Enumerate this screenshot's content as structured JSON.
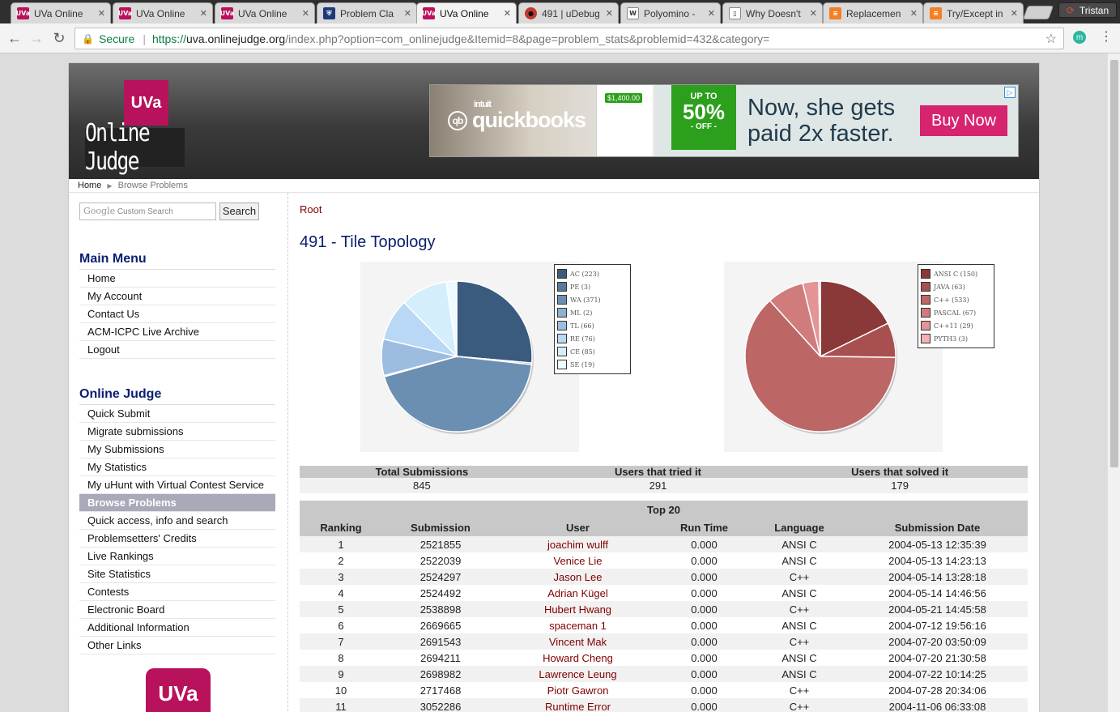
{
  "browser": {
    "tabs": [
      {
        "label": "UVa Online ",
        "favicon": "UVa",
        "color": "#b8125c"
      },
      {
        "label": "UVa Online ",
        "favicon": "UVa",
        "color": "#b8125c"
      },
      {
        "label": "UVa Online ",
        "favicon": "UVa",
        "color": "#b8125c"
      },
      {
        "label": "Problem Cla",
        "favicon": "shield",
        "color": "#1f3a7a"
      },
      {
        "label": "UVa Online ",
        "favicon": "UVa",
        "color": "#b8125c"
      },
      {
        "label": "491 | uDebug",
        "favicon": "bug",
        "color": "#c0392b"
      },
      {
        "label": "Polyomino - ",
        "favicon": "W",
        "color": "#ffffff"
      },
      {
        "label": "Why Doesn't",
        "favicon": "doc",
        "color": "#ffffff"
      },
      {
        "label": "Replacemen",
        "favicon": "stack",
        "color": "#f48024"
      },
      {
        "label": "Try/Except in",
        "favicon": "stack",
        "color": "#f48024"
      }
    ],
    "active_tab_index": 4,
    "profile_name": "Tristan",
    "secure_label": "Secure",
    "url_scheme": "https://",
    "url_host": "uva.onlinejudge.org",
    "url_path": "/index.php?option=com_onlinejudge&Itemid=8&page=problem_stats&problemid=432&category=",
    "extension_letter": "m"
  },
  "site": {
    "logo_box": "UVa",
    "logo_text": "Online Judge",
    "ad": {
      "intuit": "intuit",
      "brand": "quickbooks",
      "amount": "$1,400.00",
      "badge_top": "UP TO",
      "badge_pct": "50%",
      "badge_off": "- OFF -",
      "headline": "Now, she gets paid 2x faster.",
      "cta": "Buy Now"
    },
    "breadcrumb": {
      "home": "Home",
      "current": "Browse Problems"
    },
    "search": {
      "placeholder": "Custom Search",
      "button": "Search"
    },
    "main_menu": {
      "title": "Main Menu",
      "items": [
        "Home",
        "My Account",
        "Contact Us",
        "ACM-ICPC Live Archive",
        "Logout"
      ]
    },
    "oj_menu": {
      "title": "Online Judge",
      "items": [
        "Quick Submit",
        "Migrate submissions",
        "My Submissions",
        "My Statistics",
        "My uHunt with Virtual Contest Service",
        "Browse Problems",
        "Quick access, info and search",
        "Problemsetters' Credits",
        "Live Rankings",
        "Site Statistics",
        "Contests",
        "Electronic Board",
        "Additional Information",
        "Other Links"
      ],
      "active_index": 5
    },
    "bottom_logo": "UVa"
  },
  "problem": {
    "root_link": "Root",
    "title": "491 - Tile Topology"
  },
  "chart_data": [
    {
      "type": "pie",
      "title": "",
      "labels": [
        "AC (223)",
        "PE (3)",
        "WA (371)",
        "ML (2)",
        "TL (66)",
        "RE (76)",
        "CE (85)",
        "SE (19)"
      ],
      "values": [
        223,
        3,
        371,
        2,
        66,
        76,
        85,
        19
      ],
      "colors": [
        "#3a5a7e",
        "#5a7898",
        "#6b8fb3",
        "#8fafcd",
        "#9dbde0",
        "#b8d8f6",
        "#d4eefc",
        "#eefaff"
      ]
    },
    {
      "type": "pie",
      "title": "",
      "labels": [
        "ANSI C (150)",
        "JAVA (63)",
        "C++ (533)",
        "PASCAL (67)",
        "C++11 (29)",
        "PYTH3 (3)"
      ],
      "values": [
        150,
        63,
        533,
        67,
        29,
        3
      ],
      "colors": [
        "#8a3838",
        "#a85050",
        "#bd6666",
        "#d07c7c",
        "#e39595",
        "#f5b0b0"
      ]
    }
  ],
  "stats": {
    "headers": [
      "Total Submissions",
      "Users that tried it",
      "Users that solved it"
    ],
    "values": [
      "845",
      "291",
      "179"
    ]
  },
  "top20": {
    "caption": "Top 20",
    "headers": [
      "Ranking",
      "Submission",
      "User",
      "Run Time",
      "Language",
      "Submission Date"
    ],
    "rows": [
      [
        "1",
        "2521855",
        "joachim wulff",
        "0.000",
        "ANSI C",
        "2004-05-13 12:35:39"
      ],
      [
        "2",
        "2522039",
        "Venice Lie",
        "0.000",
        "ANSI C",
        "2004-05-13 14:23:13"
      ],
      [
        "3",
        "2524297",
        "Jason Lee",
        "0.000",
        "C++",
        "2004-05-14 13:28:18"
      ],
      [
        "4",
        "2524492",
        "Adrian Kügel",
        "0.000",
        "ANSI C",
        "2004-05-14 14:46:56"
      ],
      [
        "5",
        "2538898",
        "Hubert Hwang",
        "0.000",
        "C++",
        "2004-05-21 14:45:58"
      ],
      [
        "6",
        "2669665",
        "spaceman 1",
        "0.000",
        "ANSI C",
        "2004-07-12 19:56:16"
      ],
      [
        "7",
        "2691543",
        "Vincent Mak",
        "0.000",
        "C++",
        "2004-07-20 03:50:09"
      ],
      [
        "8",
        "2694211",
        "Howard Cheng",
        "0.000",
        "ANSI C",
        "2004-07-20 21:30:58"
      ],
      [
        "9",
        "2698982",
        "Lawrence Leung",
        "0.000",
        "ANSI C",
        "2004-07-22 10:14:25"
      ],
      [
        "10",
        "2717468",
        "Piotr Gawron",
        "0.000",
        "C++",
        "2004-07-28 20:34:06"
      ],
      [
        "11",
        "3052286",
        "Runtime Error",
        "0.000",
        "C++",
        "2004-11-06 06:33:08"
      ]
    ]
  }
}
